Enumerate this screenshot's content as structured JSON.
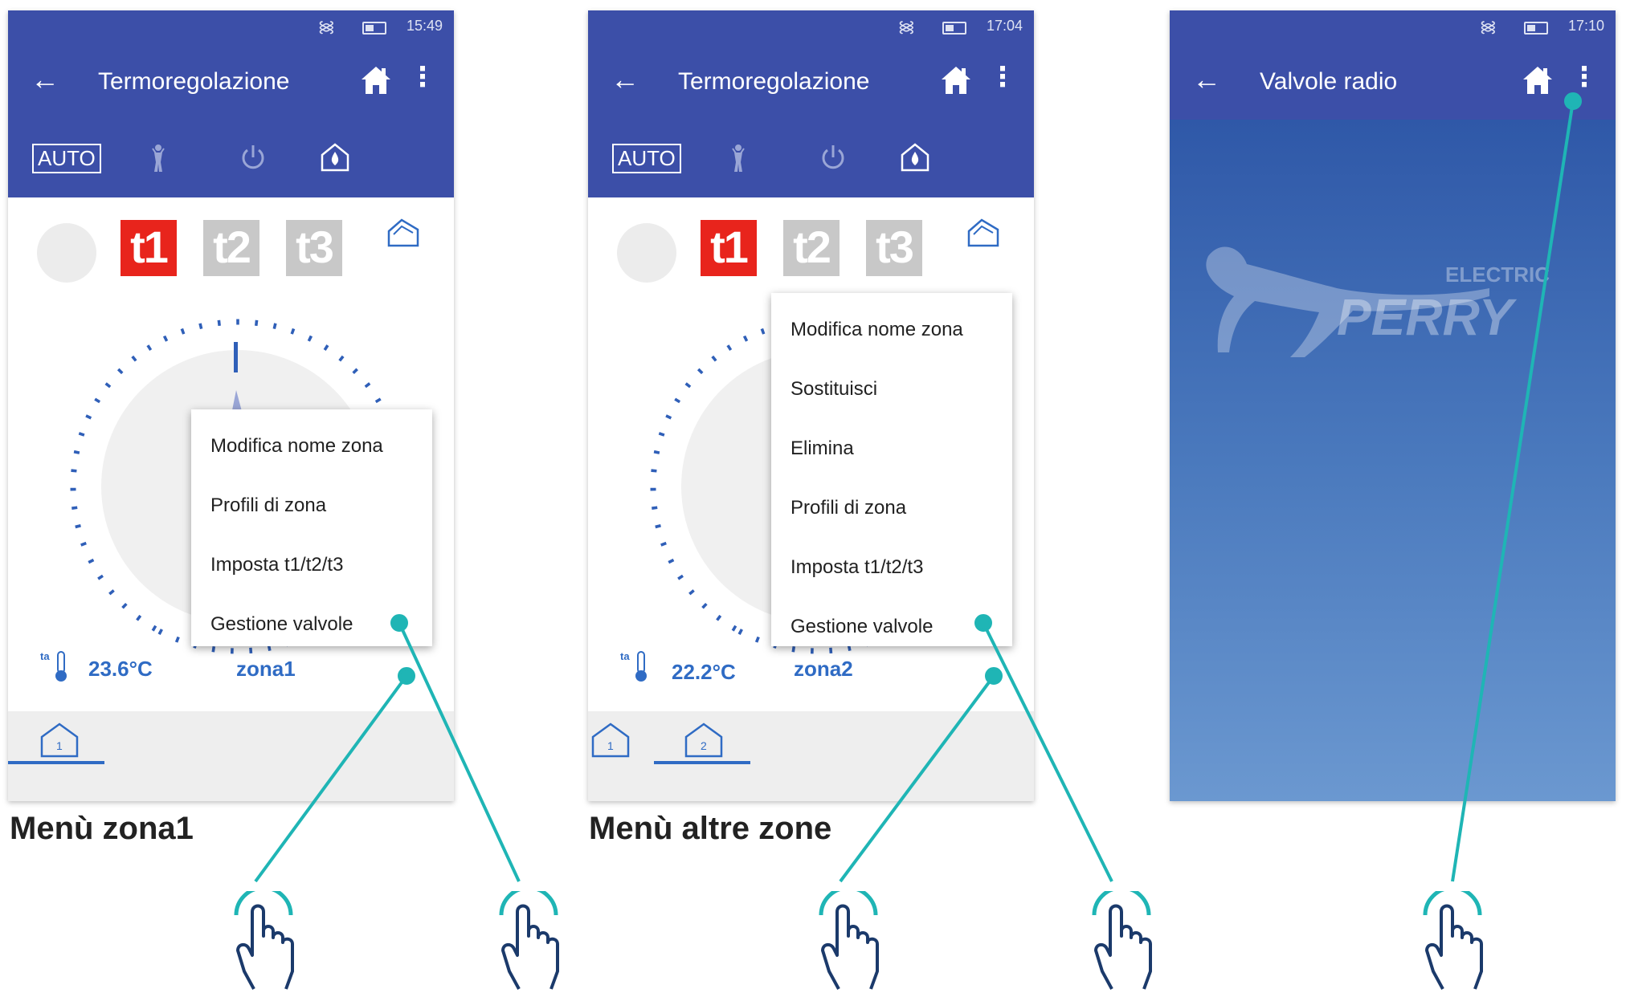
{
  "screens": [
    {
      "status_time": "15:49",
      "title": "Termoregolazione",
      "auto_label": "AUTO",
      "t_labels": [
        "t1",
        "t2",
        "t3"
      ],
      "temperature": "23.6°C",
      "thermo_label": "ta",
      "zone": "zona1",
      "menu_items": [
        "Modifica nome zona",
        "Profili di zona",
        "Imposta t1/t2/t3",
        "Gestione valvole"
      ],
      "tabs": [
        "1"
      ],
      "caption": "Menù zona1"
    },
    {
      "status_time": "17:04",
      "title": "Termoregolazione",
      "auto_label": "AUTO",
      "t_labels": [
        "t1",
        "t2",
        "t3"
      ],
      "temperature": "22.2°C",
      "thermo_label": "ta",
      "zone": "zona2",
      "menu_items": [
        "Modifica nome zona",
        "Sostituisci",
        "Elimina",
        "Profili di zona",
        "Imposta t1/t2/t3",
        "Gestione valvole"
      ],
      "tabs": [
        "1",
        "2"
      ],
      "caption": "Menù altre zone"
    },
    {
      "status_time": "17:10",
      "title": "Valvole radio",
      "logo_text_small": "ELECTRIC",
      "logo_text_big": "PERRY"
    }
  ],
  "colors": {
    "appbar": "#3c4fa8",
    "accent": "#2f6bc4",
    "t1_active": "#e8241c",
    "t_inactive": "#c8c8c8",
    "callout": "#1fb5b5",
    "hand_outline": "#1b3a6b"
  }
}
